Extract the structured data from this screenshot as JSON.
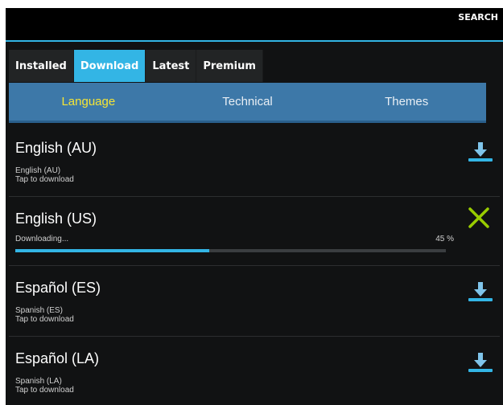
{
  "action_bar": {
    "search_label": "SEARCH"
  },
  "top_tabs": [
    {
      "label": "Installed",
      "active": false
    },
    {
      "label": "Download",
      "active": true
    },
    {
      "label": "Latest",
      "active": false
    },
    {
      "label": "Premium",
      "active": false
    }
  ],
  "sub_tabs": [
    {
      "label": "Language",
      "active": true
    },
    {
      "label": "Technical",
      "active": false
    },
    {
      "label": "Themes",
      "active": false
    }
  ],
  "items": [
    {
      "title": "English (AU)",
      "sub1": "English (AU)",
      "sub2": "Tap to download",
      "icon": "download-icon"
    },
    {
      "title": "English (US)",
      "status": "Downloading...",
      "progress_text": "45 %",
      "progress": 0.45,
      "icon": "cancel-icon"
    },
    {
      "title": "Español (ES)",
      "sub1": "Spanish (ES)",
      "sub2": "Tap to download",
      "icon": "download-icon"
    },
    {
      "title": "Español (LA)",
      "sub1": "Spanish (LA)",
      "sub2": "Tap to download",
      "icon": "download-icon"
    }
  ],
  "colors": {
    "accent": "#33b5e5",
    "subtab_bg": "#3d78a8",
    "subtab_active": "#f5e536",
    "cancel": "#99cc00"
  }
}
